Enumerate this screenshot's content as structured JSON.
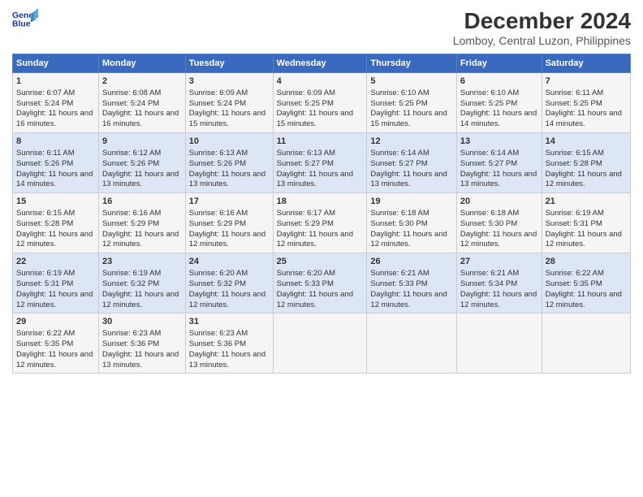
{
  "header": {
    "logo_line1": "General",
    "logo_line2": "Blue",
    "title": "December 2024",
    "subtitle": "Lomboy, Central Luzon, Philippines"
  },
  "days_of_week": [
    "Sunday",
    "Monday",
    "Tuesday",
    "Wednesday",
    "Thursday",
    "Friday",
    "Saturday"
  ],
  "weeks": [
    [
      {
        "day": 1,
        "rise": "6:07 AM",
        "set": "5:24 PM",
        "daylight": "11 hours and 16 minutes."
      },
      {
        "day": 2,
        "rise": "6:08 AM",
        "set": "5:24 PM",
        "daylight": "11 hours and 16 minutes."
      },
      {
        "day": 3,
        "rise": "6:09 AM",
        "set": "5:24 PM",
        "daylight": "11 hours and 15 minutes."
      },
      {
        "day": 4,
        "rise": "6:09 AM",
        "set": "5:25 PM",
        "daylight": "11 hours and 15 minutes."
      },
      {
        "day": 5,
        "rise": "6:10 AM",
        "set": "5:25 PM",
        "daylight": "11 hours and 15 minutes."
      },
      {
        "day": 6,
        "rise": "6:10 AM",
        "set": "5:25 PM",
        "daylight": "11 hours and 14 minutes."
      },
      {
        "day": 7,
        "rise": "6:11 AM",
        "set": "5:25 PM",
        "daylight": "11 hours and 14 minutes."
      }
    ],
    [
      {
        "day": 8,
        "rise": "6:11 AM",
        "set": "5:26 PM",
        "daylight": "11 hours and 14 minutes."
      },
      {
        "day": 9,
        "rise": "6:12 AM",
        "set": "5:26 PM",
        "daylight": "11 hours and 13 minutes."
      },
      {
        "day": 10,
        "rise": "6:13 AM",
        "set": "5:26 PM",
        "daylight": "11 hours and 13 minutes."
      },
      {
        "day": 11,
        "rise": "6:13 AM",
        "set": "5:27 PM",
        "daylight": "11 hours and 13 minutes."
      },
      {
        "day": 12,
        "rise": "6:14 AM",
        "set": "5:27 PM",
        "daylight": "11 hours and 13 minutes."
      },
      {
        "day": 13,
        "rise": "6:14 AM",
        "set": "5:27 PM",
        "daylight": "11 hours and 13 minutes."
      },
      {
        "day": 14,
        "rise": "6:15 AM",
        "set": "5:28 PM",
        "daylight": "11 hours and 12 minutes."
      }
    ],
    [
      {
        "day": 15,
        "rise": "6:15 AM",
        "set": "5:28 PM",
        "daylight": "11 hours and 12 minutes."
      },
      {
        "day": 16,
        "rise": "6:16 AM",
        "set": "5:29 PM",
        "daylight": "11 hours and 12 minutes."
      },
      {
        "day": 17,
        "rise": "6:16 AM",
        "set": "5:29 PM",
        "daylight": "11 hours and 12 minutes."
      },
      {
        "day": 18,
        "rise": "6:17 AM",
        "set": "5:29 PM",
        "daylight": "11 hours and 12 minutes."
      },
      {
        "day": 19,
        "rise": "6:18 AM",
        "set": "5:30 PM",
        "daylight": "11 hours and 12 minutes."
      },
      {
        "day": 20,
        "rise": "6:18 AM",
        "set": "5:30 PM",
        "daylight": "11 hours and 12 minutes."
      },
      {
        "day": 21,
        "rise": "6:19 AM",
        "set": "5:31 PM",
        "daylight": "11 hours and 12 minutes."
      }
    ],
    [
      {
        "day": 22,
        "rise": "6:19 AM",
        "set": "5:31 PM",
        "daylight": "11 hours and 12 minutes."
      },
      {
        "day": 23,
        "rise": "6:19 AM",
        "set": "5:32 PM",
        "daylight": "11 hours and 12 minutes."
      },
      {
        "day": 24,
        "rise": "6:20 AM",
        "set": "5:32 PM",
        "daylight": "11 hours and 12 minutes."
      },
      {
        "day": 25,
        "rise": "6:20 AM",
        "set": "5:33 PM",
        "daylight": "11 hours and 12 minutes."
      },
      {
        "day": 26,
        "rise": "6:21 AM",
        "set": "5:33 PM",
        "daylight": "11 hours and 12 minutes."
      },
      {
        "day": 27,
        "rise": "6:21 AM",
        "set": "5:34 PM",
        "daylight": "11 hours and 12 minutes."
      },
      {
        "day": 28,
        "rise": "6:22 AM",
        "set": "5:35 PM",
        "daylight": "11 hours and 12 minutes."
      }
    ],
    [
      {
        "day": 29,
        "rise": "6:22 AM",
        "set": "5:35 PM",
        "daylight": "11 hours and 12 minutes."
      },
      {
        "day": 30,
        "rise": "6:23 AM",
        "set": "5:36 PM",
        "daylight": "11 hours and 13 minutes."
      },
      {
        "day": 31,
        "rise": "6:23 AM",
        "set": "5:36 PM",
        "daylight": "11 hours and 13 minutes."
      },
      null,
      null,
      null,
      null
    ]
  ]
}
